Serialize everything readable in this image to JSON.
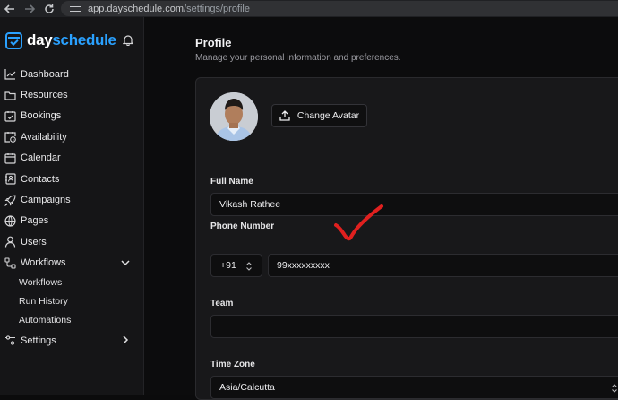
{
  "browser": {
    "url_host": "app.dayschedule.com",
    "url_path": "/settings/profile"
  },
  "brand": {
    "part1": "day",
    "part2": "schedule"
  },
  "sidebar": {
    "items": [
      {
        "label": "Dashboard",
        "icon": "chart-line-icon"
      },
      {
        "label": "Resources",
        "icon": "folder-icon"
      },
      {
        "label": "Bookings",
        "icon": "calendar-check-icon"
      },
      {
        "label": "Availability",
        "icon": "calendar-clock-icon"
      },
      {
        "label": "Calendar",
        "icon": "calendar-icon"
      },
      {
        "label": "Contacts",
        "icon": "contact-card-icon"
      },
      {
        "label": "Campaigns",
        "icon": "rocket-icon"
      },
      {
        "label": "Pages",
        "icon": "globe-icon"
      },
      {
        "label": "Users",
        "icon": "user-icon"
      },
      {
        "label": "Workflows",
        "icon": "workflow-icon"
      }
    ],
    "workflow_subitems": [
      "Workflows",
      "Run History",
      "Automations"
    ],
    "settings_label": "Settings"
  },
  "profile": {
    "title": "Profile",
    "subtitle": "Manage your personal information and preferences.",
    "change_avatar": "Change Avatar",
    "full_name_label": "Full Name",
    "full_name_value": "Vikash Rathee",
    "phone_label": "Phone Number",
    "country_code": "+91",
    "phone_value": "99xxxxxxxxx",
    "team_label": "Team",
    "team_value": "",
    "timezone_label": "Time Zone",
    "timezone_value": "Asia/Calcutta"
  },
  "colors": {
    "accent": "#2aa1ff",
    "annotation": "#e0201f"
  }
}
